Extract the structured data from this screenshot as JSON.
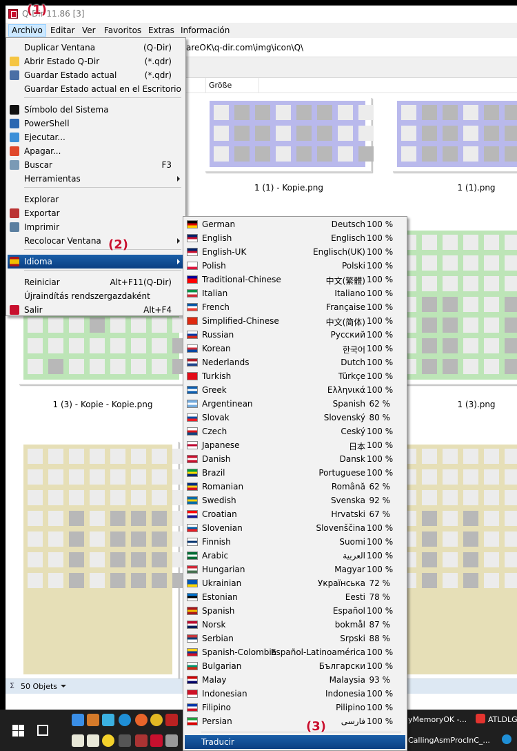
{
  "window": {
    "title": "Q-Dir 11.86 [3]",
    "menubar": [
      "Archivo",
      "Editar",
      "Ver",
      "Favoritos",
      "Extras",
      "Información"
    ],
    "active_menu": "Archivo",
    "address_path": "areOK\\q-dir.com\\img\\icon\\Q\\",
    "column_header": "Größe",
    "status_text": "50 Objets",
    "status_sigma": "Σ"
  },
  "thumbnails": [
    {
      "caption": "1 (1) - Kopie.png",
      "color": "#b9b9ec"
    },
    {
      "caption": "1 (1).png",
      "color": "#b9b9ec"
    },
    {
      "caption": "1 (3) - Kopie - Kopie.png",
      "color": "#bde5b7"
    },
    {
      "caption": "1 (3).png",
      "color": "#bde5b7"
    },
    {
      "caption": "",
      "color": "#e6dfb7"
    },
    {
      "caption": "",
      "color": "#e6dfb7"
    }
  ],
  "archivo_menu": [
    {
      "label": "Duplicar Ventana",
      "accel": "(Q-Dir)",
      "icon": "none-icon"
    },
    {
      "label": "Abrir Estado Q-Dir",
      "accel": "(*.qdr)",
      "icon": "folder-icon"
    },
    {
      "label": "Guardar Estado actual",
      "accel": "(*.qdr)",
      "icon": "floppy-icon"
    },
    {
      "label": "Guardar Estado actual en el Escritorio",
      "accel": "",
      "icon": "none-icon"
    },
    {
      "label": "Símbolo del Sistema",
      "accel": "",
      "icon": "cmd-icon"
    },
    {
      "label": "PowerShell",
      "accel": "",
      "icon": "powershell-icon"
    },
    {
      "label": "Ejecutar...",
      "accel": "",
      "icon": "run-icon"
    },
    {
      "label": "Apagar...",
      "accel": "",
      "icon": "power-icon"
    },
    {
      "label": "Buscar",
      "accel": "F3",
      "icon": "search-icon"
    },
    {
      "label": "Herramientas",
      "accel": "",
      "icon": "none-icon"
    },
    {
      "label": "Explorar",
      "accel": "",
      "icon": "none-icon"
    },
    {
      "label": "Exportar",
      "accel": "",
      "icon": "export-icon"
    },
    {
      "label": "Imprimir",
      "accel": "",
      "icon": "printer-icon"
    },
    {
      "label": "Recolocar Ventana",
      "accel": "",
      "icon": "none-icon"
    },
    {
      "label": "Idioma",
      "accel": "",
      "icon": "spain-flag-icon"
    },
    {
      "label": "Reiniciar",
      "accel": "Alt+F11(Q-Dir)",
      "icon": "none-icon"
    },
    {
      "label": "Újraindítás rendszergazdaként",
      "accel": "",
      "icon": "none-icon"
    },
    {
      "label": "Salir",
      "accel": "Alt+F4",
      "icon": "exit-icon"
    }
  ],
  "languages": [
    {
      "en": "German",
      "native": "Deutsch",
      "pct": "100 %",
      "flag": [
        "#000000",
        "#dd0000",
        "#ffce00"
      ]
    },
    {
      "en": "English",
      "native": "Englisch",
      "pct": "100 %",
      "flag": [
        "#012169",
        "#c8102e",
        "#ffffff"
      ]
    },
    {
      "en": "English-UK",
      "native": "Englisch(UK)",
      "pct": "100 %",
      "flag": [
        "#012169",
        "#c8102e",
        "#ffffff"
      ]
    },
    {
      "en": "Polish",
      "native": "Polski",
      "pct": "100 %",
      "flag": [
        "#ffffff",
        "#ffffff",
        "#dc143c"
      ]
    },
    {
      "en": "Traditional-Chinese",
      "native": "中文(繁體)",
      "pct": "100 %",
      "flag": [
        "#000095",
        "#fe0000",
        "#fe0000"
      ]
    },
    {
      "en": "Italian",
      "native": "Italiano",
      "pct": "100 %",
      "flag": [
        "#009246",
        "#ffffff",
        "#ce2b37"
      ]
    },
    {
      "en": "French",
      "native": "Française",
      "pct": "100 %",
      "flag": [
        "#0055a4",
        "#ffffff",
        "#ef4135"
      ]
    },
    {
      "en": "Simplified-Chinese",
      "native": "中文(简体)",
      "pct": "100 %",
      "flag": [
        "#de2910",
        "#de2910",
        "#de2910"
      ]
    },
    {
      "en": "Russian",
      "native": "Русский",
      "pct": "100 %",
      "flag": [
        "#ffffff",
        "#0039a6",
        "#d52b1e"
      ]
    },
    {
      "en": "Korean",
      "native": "한국어",
      "pct": "100 %",
      "flag": [
        "#ffffff",
        "#cd2e3a",
        "#0047a0"
      ]
    },
    {
      "en": "Nederlands",
      "native": "Dutch",
      "pct": "100 %",
      "flag": [
        "#ae1c28",
        "#ffffff",
        "#21468b"
      ]
    },
    {
      "en": "Turkish",
      "native": "Türkçe",
      "pct": "100 %",
      "flag": [
        "#e30a17",
        "#e30a17",
        "#e30a17"
      ]
    },
    {
      "en": "Greek",
      "native": "Ελληνικά",
      "pct": "100 %",
      "flag": [
        "#0d5eaf",
        "#ffffff",
        "#0d5eaf"
      ]
    },
    {
      "en": "Argentinean",
      "native": "Spanish",
      "pct": "62 %",
      "flag": [
        "#74acdf",
        "#ffffff",
        "#74acdf"
      ]
    },
    {
      "en": "Slovak",
      "native": "Slovenský",
      "pct": "80 %",
      "flag": [
        "#ffffff",
        "#0b4ea2",
        "#ee1c25"
      ]
    },
    {
      "en": "Czech",
      "native": "Ceský",
      "pct": "100 %",
      "flag": [
        "#ffffff",
        "#d7141a",
        "#11457e"
      ]
    },
    {
      "en": "Japanese",
      "native": "日本",
      "pct": "100 %",
      "flag": [
        "#ffffff",
        "#bc002d",
        "#ffffff"
      ]
    },
    {
      "en": "Danish",
      "native": "Dansk",
      "pct": "100 %",
      "flag": [
        "#c8102e",
        "#ffffff",
        "#c8102e"
      ]
    },
    {
      "en": "Brazil",
      "native": "Portuguese",
      "pct": "100 %",
      "flag": [
        "#009c3b",
        "#ffdf00",
        "#002776"
      ]
    },
    {
      "en": "Romanian",
      "native": "Română",
      "pct": "62 %",
      "flag": [
        "#002b7f",
        "#fcd116",
        "#ce1126"
      ]
    },
    {
      "en": "Swedish",
      "native": "Svenska",
      "pct": "92 %",
      "flag": [
        "#006aa7",
        "#fecc00",
        "#006aa7"
      ]
    },
    {
      "en": "Croatian",
      "native": "Hrvatski",
      "pct": "67 %",
      "flag": [
        "#ff0000",
        "#ffffff",
        "#171796"
      ]
    },
    {
      "en": "Slovenian",
      "native": "Slovenščina",
      "pct": "100 %",
      "flag": [
        "#ffffff",
        "#005da4",
        "#ed1c24"
      ]
    },
    {
      "en": "Finnish",
      "native": "Suomi",
      "pct": "100 %",
      "flag": [
        "#ffffff",
        "#002f6c",
        "#ffffff"
      ]
    },
    {
      "en": "Arabic",
      "native": "العربية",
      "pct": "100 %",
      "flag": [
        "#006c35",
        "#ffffff",
        "#006c35"
      ]
    },
    {
      "en": "Hungarian",
      "native": "Magyar",
      "pct": "100 %",
      "flag": [
        "#ce2939",
        "#ffffff",
        "#477050"
      ]
    },
    {
      "en": "Ukrainian",
      "native": "Українська",
      "pct": "72 %",
      "flag": [
        "#0057b7",
        "#0057b7",
        "#ffd700"
      ]
    },
    {
      "en": "Estonian",
      "native": "Eesti",
      "pct": "78 %",
      "flag": [
        "#0072ce",
        "#000000",
        "#ffffff"
      ]
    },
    {
      "en": "Spanish",
      "native": "Español",
      "pct": "100 %",
      "flag": [
        "#aa151b",
        "#f1bf00",
        "#aa151b"
      ]
    },
    {
      "en": "Norsk",
      "native": "bokmål",
      "pct": "87 %",
      "flag": [
        "#ba0c2f",
        "#ffffff",
        "#00205b"
      ]
    },
    {
      "en": "Serbian",
      "native": "Srpski",
      "pct": "88 %",
      "flag": [
        "#c6363c",
        "#0c4076",
        "#ffffff"
      ]
    },
    {
      "en": "Spanish-Colombia",
      "native": "Español-Latinoamérica",
      "pct": "100 %",
      "flag": [
        "#fcd116",
        "#003893",
        "#ce1126"
      ]
    },
    {
      "en": "Bulgarian",
      "native": "Български",
      "pct": "100 %",
      "flag": [
        "#ffffff",
        "#00966e",
        "#d62612"
      ]
    },
    {
      "en": "Malay",
      "native": "Malaysia",
      "pct": "93 %",
      "flag": [
        "#cc0001",
        "#ffffff",
        "#010066"
      ]
    },
    {
      "en": "Indonesian",
      "native": "Indonesia",
      "pct": "100 %",
      "flag": [
        "#ce1126",
        "#ce1126",
        "#ffffff"
      ]
    },
    {
      "en": "Filipino",
      "native": "Pilipino",
      "pct": "100 %",
      "flag": [
        "#0038a8",
        "#ffffff",
        "#ce1126"
      ]
    },
    {
      "en": "Persian",
      "native": "فارسی",
      "pct": "100 %",
      "flag": [
        "#239f40",
        "#ffffff",
        "#da0000"
      ]
    }
  ],
  "translate_label": "Traducir",
  "annotations": [
    "(1)",
    "(2)",
    "(3)"
  ],
  "taskbar": {
    "items": [
      "yMemoryOK -...",
      "ATLDLG",
      "CallingAsmProcInC_..."
    ]
  },
  "colors": {
    "menu_highlight": "#0b3f82",
    "annotation": "#c8102e",
    "status_bar": "#dde8f3"
  }
}
